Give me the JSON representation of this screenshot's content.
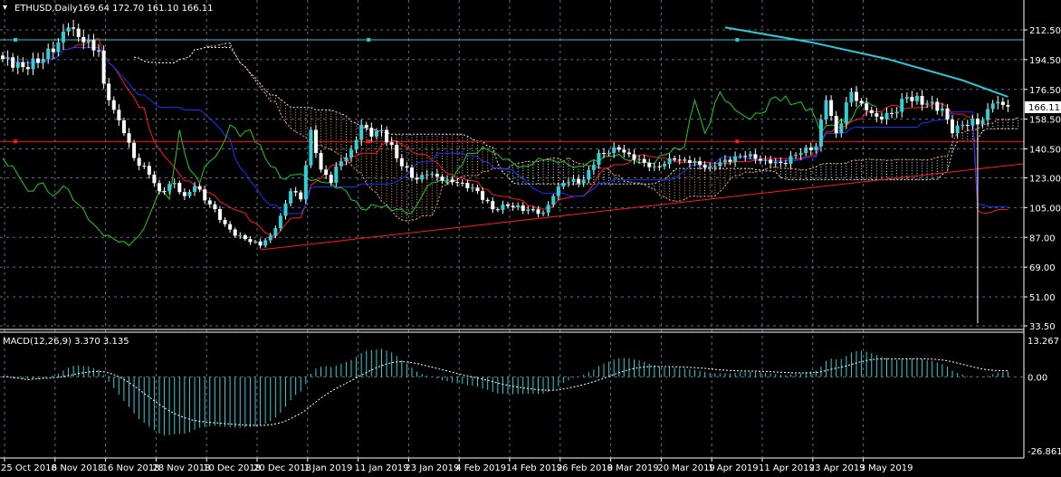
{
  "header": {
    "symbol_label": "ETHUSD,Daily",
    "ohlc_label": "169.64 172.70 161.10 166.11"
  },
  "macd_header": {
    "label": "MACD(12,26,9) 3.370 3.135"
  },
  "current_price_label": "166.11",
  "colors": {
    "background": "#000000",
    "grid": "#5c6e80",
    "bull": "#2fd0d8",
    "bear": "#ffffff",
    "tenkan": "#ff1a1a",
    "kijun": "#1a33ff",
    "chikou": "#22cc22",
    "cloud_up": "#e8e8e8",
    "cloud_down": "#f4a460",
    "ma": "#2fc8d8",
    "hline_cyan": "#2fc8d8",
    "hline_red": "#ff1a1a",
    "trendline": "#ff1a1a",
    "macd_hist": "#2fd0d8",
    "macd_signal": "#ffffff"
  },
  "chart_data": [
    {
      "type": "candlestick",
      "title": "ETHUSD,Daily",
      "yaxis_ticks": [
        "212.50",
        "194.50",
        "176.50",
        "158.50",
        "140.50",
        "123.00",
        "105.00",
        "87.00",
        "69.00",
        "51.00",
        "33.50"
      ],
      "ylim": [
        33.5,
        212.5
      ],
      "xaxis_ticks": [
        "25 Oct 2018",
        "6 Nov 2018",
        "16 Nov 2018",
        "28 Nov 2018",
        "10 Dec 2018",
        "20 Dec 2018",
        "1 Jan 2019",
        "11 Jan 2019",
        "23 Jan 2019",
        "4 Feb 2019",
        "14 Feb 2019",
        "26 Feb 2019",
        "8 Mar 2019",
        "20 Mar 2019",
        "1 Apr 2019",
        "11 Apr 2019",
        "23 Apr 2019",
        "3 May 2019"
      ],
      "bars_per_tick": 10,
      "bar_count": 200,
      "close_keypoints": [
        [
          0,
          195
        ],
        [
          4,
          190
        ],
        [
          8,
          195
        ],
        [
          11,
          205
        ],
        [
          13,
          214
        ],
        [
          16,
          205
        ],
        [
          19,
          200
        ],
        [
          20,
          180
        ],
        [
          21,
          170
        ],
        [
          24,
          150
        ],
        [
          26,
          135
        ],
        [
          29,
          125
        ],
        [
          31,
          115
        ],
        [
          34,
          120
        ],
        [
          36,
          112
        ],
        [
          38,
          118
        ],
        [
          41,
          107
        ],
        [
          44,
          95
        ],
        [
          46,
          88
        ],
        [
          48,
          86
        ],
        [
          51,
          82
        ],
        [
          53,
          88
        ],
        [
          55,
          100
        ],
        [
          57,
          115
        ],
        [
          59,
          110
        ],
        [
          61,
          152
        ],
        [
          63,
          128
        ],
        [
          65,
          120
        ],
        [
          66,
          130
        ],
        [
          69,
          140
        ],
        [
          71,
          155
        ],
        [
          73,
          148
        ],
        [
          75,
          152
        ],
        [
          79,
          130
        ],
        [
          82,
          122
        ],
        [
          84,
          125
        ],
        [
          88,
          122
        ],
        [
          91,
          120
        ],
        [
          94,
          115
        ],
        [
          97,
          104
        ],
        [
          100,
          106
        ],
        [
          104,
          104
        ],
        [
          107,
          102
        ],
        [
          109,
          112
        ],
        [
          111,
          120
        ],
        [
          115,
          122
        ],
        [
          118,
          138
        ],
        [
          122,
          140
        ],
        [
          125,
          134
        ],
        [
          129,
          130
        ],
        [
          133,
          134
        ],
        [
          136,
          132
        ],
        [
          140,
          130
        ],
        [
          143,
          134
        ],
        [
          147,
          136
        ],
        [
          151,
          134
        ],
        [
          154,
          132
        ],
        [
          158,
          138
        ],
        [
          161,
          142
        ],
        [
          163,
          170
        ],
        [
          165,
          150
        ],
        [
          168,
          175
        ],
        [
          170,
          168
        ],
        [
          173,
          160
        ],
        [
          176,
          162
        ],
        [
          179,
          172
        ],
        [
          183,
          168
        ],
        [
          186,
          165
        ],
        [
          188,
          150
        ],
        [
          190,
          155
        ],
        [
          194,
          158
        ],
        [
          196,
          168
        ],
        [
          199,
          166.11
        ]
      ],
      "special_lows": [
        [
          193,
          35
        ]
      ],
      "moving_average": {
        "points": [
          [
            143,
            214
          ],
          [
            160,
            205
          ],
          [
            175,
            195
          ],
          [
            190,
            182
          ],
          [
            199,
            172
          ]
        ]
      },
      "horizontal_lines": [
        {
          "price": 206.5,
          "color": "cyan"
        },
        {
          "price": 145,
          "color": "red"
        }
      ],
      "trendline": {
        "from": [
          51,
          79.5
        ],
        "to": [
          202,
          131.5
        ]
      },
      "last_price": 166.11
    },
    {
      "type": "bar",
      "title": "MACD(12,26,9)",
      "params": [
        12,
        26,
        9
      ],
      "macd": 3.37,
      "signal": 3.135,
      "yaxis_ticks": [
        "13.267",
        "0.00",
        "-26.861"
      ],
      "ylim": [
        -26.861,
        13.267
      ]
    }
  ]
}
